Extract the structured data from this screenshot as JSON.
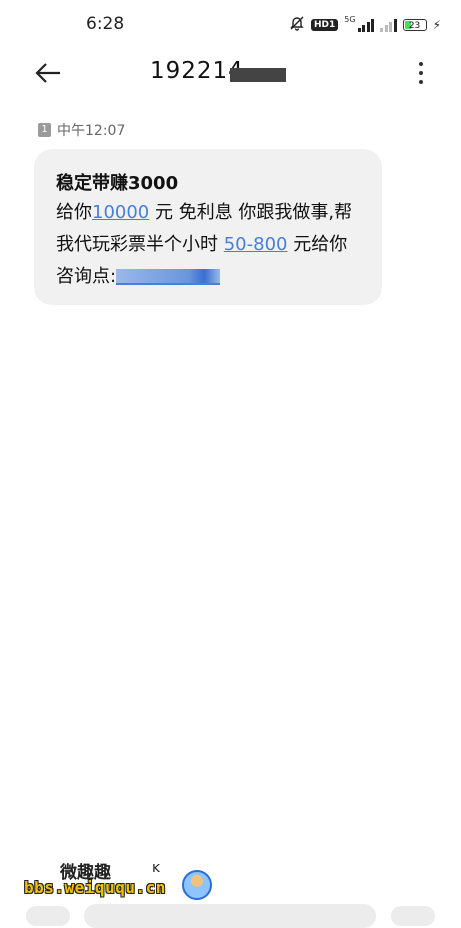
{
  "status_bar": {
    "time": "6:28",
    "network_label": "5G",
    "hd_badge": "HD1",
    "battery": "23",
    "icons": [
      "mute-bell-icon",
      "signal-icon",
      "signal-icon",
      "battery-icon",
      "charging-icon"
    ]
  },
  "header": {
    "sender": "192214",
    "back_icon": "arrow-left-icon",
    "more_icon": "more-vertical-icon"
  },
  "message": {
    "sim": "1",
    "time": "中午12:07",
    "title": "稳定带赚3000",
    "line1_prefix": "给你",
    "amount_link": "10000",
    "line1_suffix": " 元 免利息 你跟我做事,帮",
    "line2_prefix": "我代玩彩票半个小时 ",
    "range_link": "50-800",
    "line2_suffix": " 元给你",
    "line3_prefix": "咨询点:",
    "url_link": "d..."
  },
  "watermark": {
    "top": "微趣趣",
    "bottom": "bbs.weiququ.cn",
    "mark": "ĸ"
  }
}
